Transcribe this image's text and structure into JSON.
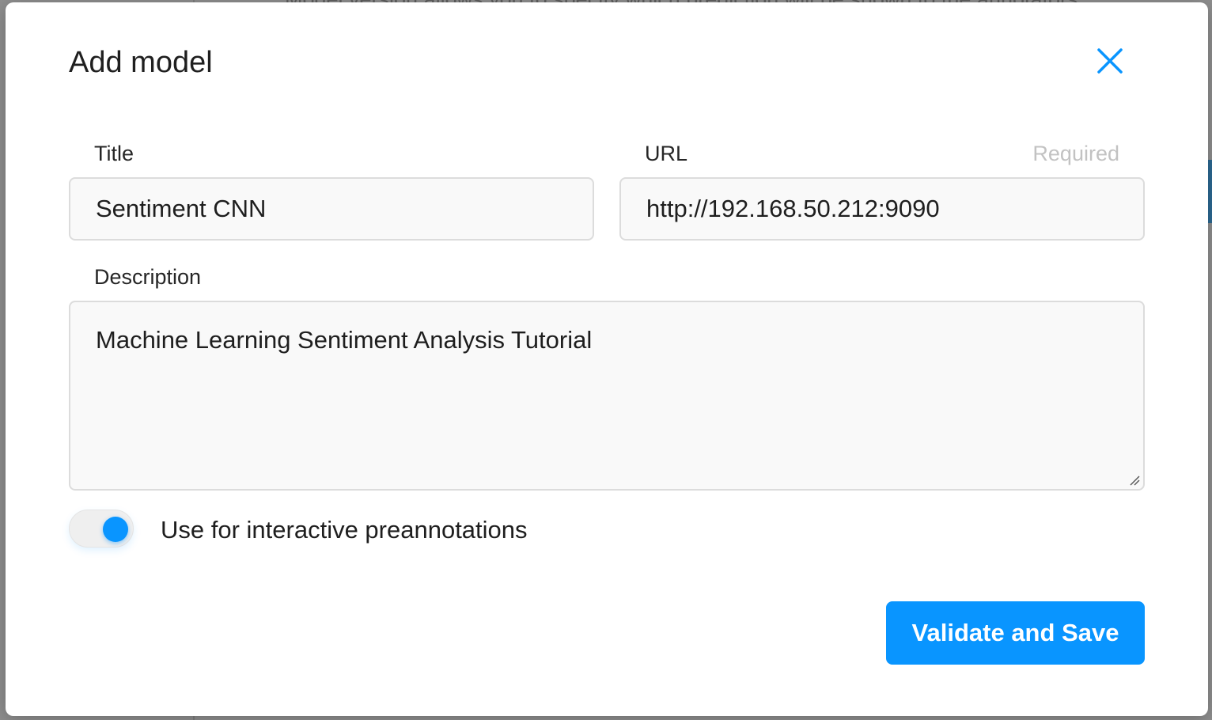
{
  "background": {
    "partial_text": "Model version allows you to specify which prediction will be shown to the annotators"
  },
  "modal": {
    "title": "Add model",
    "close_icon": "close-icon",
    "fields": {
      "title": {
        "label": "Title",
        "value": "Sentiment CNN"
      },
      "url": {
        "label": "URL",
        "hint": "Required",
        "value": "http://192.168.50.212:9090"
      },
      "description": {
        "label": "Description",
        "value": "Machine Learning Sentiment Analysis Tutorial"
      }
    },
    "interactive_toggle": {
      "label": "Use for interactive preannotations",
      "checked": true
    },
    "submit_label": "Validate and Save"
  },
  "colors": {
    "accent": "#0995ff",
    "input_background": "#f9f9f9",
    "input_border": "#dcdcdc",
    "hint_text": "#c2c2c2"
  }
}
